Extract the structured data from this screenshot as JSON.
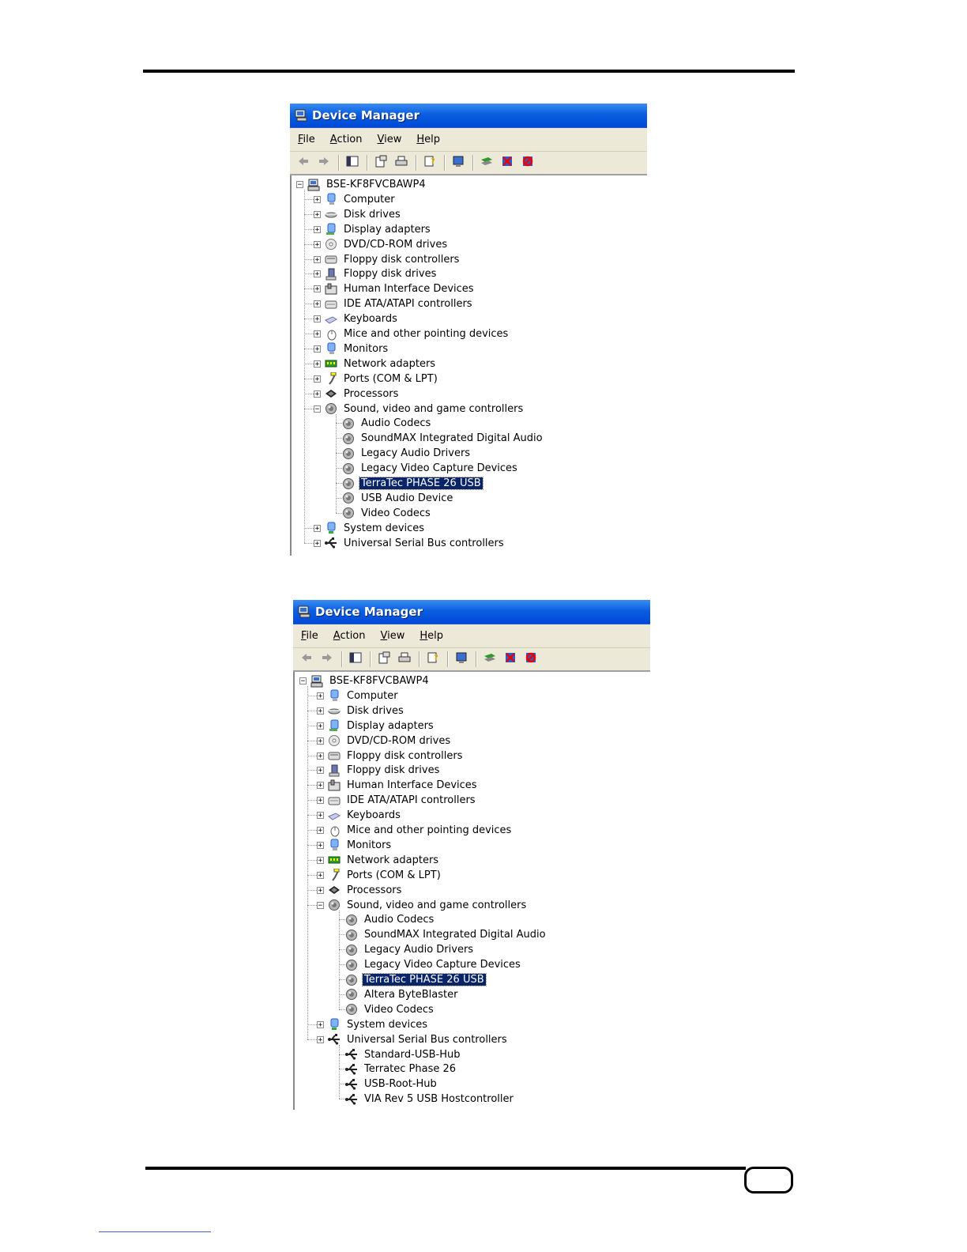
{
  "windows": [
    {
      "title": "Device Manager",
      "menu": [
        {
          "u": "F",
          "rest": "ile"
        },
        {
          "u": "A",
          "rest": "ction"
        },
        {
          "u": "V",
          "rest": "iew"
        },
        {
          "u": "H",
          "rest": "elp"
        }
      ],
      "root": "BSE-KF8FVCBAWP4",
      "categories": [
        {
          "label": "Computer",
          "icon": "computer-icon",
          "exp": "+"
        },
        {
          "label": "Disk drives",
          "icon": "disk-drive-icon",
          "exp": "+"
        },
        {
          "label": "Display adapters",
          "icon": "display-adapter-icon",
          "exp": "+"
        },
        {
          "label": "DVD/CD-ROM drives",
          "icon": "cdrom-icon",
          "exp": "+"
        },
        {
          "label": "Floppy disk controllers",
          "icon": "floppy-controller-icon",
          "exp": "+"
        },
        {
          "label": "Floppy disk drives",
          "icon": "floppy-drive-icon",
          "exp": "+"
        },
        {
          "label": "Human Interface Devices",
          "icon": "hid-icon",
          "exp": "+"
        },
        {
          "label": "IDE ATA/ATAPI controllers",
          "icon": "ide-controller-icon",
          "exp": "+"
        },
        {
          "label": "Keyboards",
          "icon": "keyboard-icon",
          "exp": "+"
        },
        {
          "label": "Mice and other pointing devices",
          "icon": "mouse-icon",
          "exp": "+"
        },
        {
          "label": "Monitors",
          "icon": "monitor-icon",
          "exp": "+"
        },
        {
          "label": "Network adapters",
          "icon": "network-adapter-icon",
          "exp": "+"
        },
        {
          "label": "Ports (COM & LPT)",
          "icon": "port-icon",
          "exp": "+"
        },
        {
          "label": "Processors",
          "icon": "processor-icon",
          "exp": "+"
        },
        {
          "label": "Sound, video and game controllers",
          "icon": "sound-icon",
          "exp": "-",
          "children": [
            {
              "label": "Audio Codecs",
              "icon": "sound-icon"
            },
            {
              "label": "SoundMAX Integrated Digital Audio",
              "icon": "sound-icon"
            },
            {
              "label": "Legacy Audio Drivers",
              "icon": "sound-icon"
            },
            {
              "label": "Legacy Video Capture Devices",
              "icon": "sound-icon"
            },
            {
              "label": "TerraTec PHASE 26 USB",
              "icon": "sound-icon",
              "selected": true
            },
            {
              "label": "USB Audio Device",
              "icon": "sound-icon"
            },
            {
              "label": "Video Codecs",
              "icon": "sound-icon"
            }
          ]
        },
        {
          "label": "System devices",
          "icon": "system-device-icon",
          "exp": "+"
        },
        {
          "label": "Universal Serial Bus controllers",
          "icon": "usb-icon",
          "exp": "+"
        }
      ]
    },
    {
      "title": "Device Manager",
      "menu": [
        {
          "u": "F",
          "rest": "ile"
        },
        {
          "u": "A",
          "rest": "ction"
        },
        {
          "u": "V",
          "rest": "iew"
        },
        {
          "u": "H",
          "rest": "elp"
        }
      ],
      "root": "BSE-KF8FVCBAWP4",
      "categories": [
        {
          "label": "Computer",
          "icon": "computer-icon",
          "exp": "+"
        },
        {
          "label": "Disk drives",
          "icon": "disk-drive-icon",
          "exp": "+"
        },
        {
          "label": "Display adapters",
          "icon": "display-adapter-icon",
          "exp": "+"
        },
        {
          "label": "DVD/CD-ROM drives",
          "icon": "cdrom-icon",
          "exp": "+"
        },
        {
          "label": "Floppy disk controllers",
          "icon": "floppy-controller-icon",
          "exp": "+"
        },
        {
          "label": "Floppy disk drives",
          "icon": "floppy-drive-icon",
          "exp": "+"
        },
        {
          "label": "Human Interface Devices",
          "icon": "hid-icon",
          "exp": "+"
        },
        {
          "label": "IDE ATA/ATAPI controllers",
          "icon": "ide-controller-icon",
          "exp": "+"
        },
        {
          "label": "Keyboards",
          "icon": "keyboard-icon",
          "exp": "+"
        },
        {
          "label": "Mice and other pointing devices",
          "icon": "mouse-icon",
          "exp": "+"
        },
        {
          "label": "Monitors",
          "icon": "monitor-icon",
          "exp": "+"
        },
        {
          "label": "Network adapters",
          "icon": "network-adapter-icon",
          "exp": "+"
        },
        {
          "label": "Ports (COM & LPT)",
          "icon": "port-icon",
          "exp": "+"
        },
        {
          "label": "Processors",
          "icon": "processor-icon",
          "exp": "+"
        },
        {
          "label": "Sound, video and game controllers",
          "icon": "sound-icon",
          "exp": "-",
          "children": [
            {
              "label": "Audio Codecs",
              "icon": "sound-icon"
            },
            {
              "label": "SoundMAX Integrated Digital Audio",
              "icon": "sound-icon"
            },
            {
              "label": "Legacy Audio Drivers",
              "icon": "sound-icon"
            },
            {
              "label": "Legacy Video Capture Devices",
              "icon": "sound-icon"
            },
            {
              "label": "TerraTec PHASE 26 USB",
              "icon": "sound-icon",
              "selected": true
            },
            {
              "label": "Altera ByteBlaster",
              "icon": "sound-icon"
            },
            {
              "label": "Video Codecs",
              "icon": "sound-icon"
            }
          ]
        },
        {
          "label": "System devices",
          "icon": "system-device-icon",
          "exp": "+"
        },
        {
          "label": "Universal Serial Bus controllers",
          "icon": "usb-icon",
          "exp": "+",
          "children": [
            {
              "label": "Standard-USB-Hub",
              "icon": "usb-icon"
            },
            {
              "label": "Terratec Phase 26",
              "icon": "usb-icon"
            },
            {
              "label": "USB-Root-Hub",
              "icon": "usb-icon"
            },
            {
              "label": "VIA Rev 5 USB Hostcontroller",
              "icon": "usb-icon"
            }
          ]
        }
      ]
    }
  ],
  "toolbar_icons": [
    "back-icon",
    "forward-icon",
    "|",
    "show-hide-tree-icon",
    "|",
    "properties-icon",
    "print-icon",
    "|",
    "help-icon",
    "|",
    "scan-hardware-icon",
    "|",
    "update-driver-icon",
    "disable-device-icon",
    "uninstall-device-icon"
  ]
}
